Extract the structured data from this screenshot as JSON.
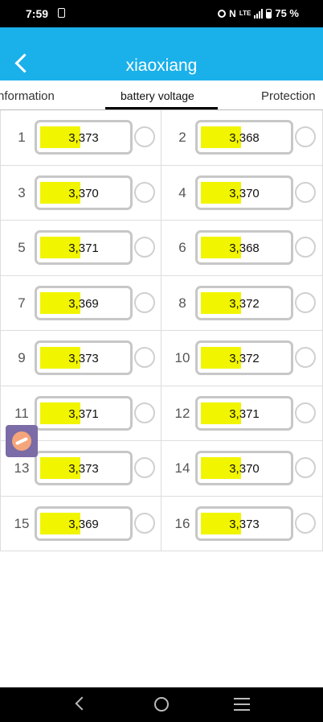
{
  "status_bar": {
    "time": "7:59",
    "battery_percent": "75 %",
    "network_label": "LTE"
  },
  "app_bar": {
    "title": "xiaoxiang"
  },
  "tabs": [
    {
      "label": "nformation"
    },
    {
      "label": "battery voltage",
      "selected": true
    },
    {
      "label": "Protection"
    }
  ],
  "cells": [
    {
      "index": "1",
      "value": "3,373"
    },
    {
      "index": "2",
      "value": "3,368"
    },
    {
      "index": "3",
      "value": "3,370"
    },
    {
      "index": "4",
      "value": "3,370"
    },
    {
      "index": "5",
      "value": "3,371"
    },
    {
      "index": "6",
      "value": "3,368"
    },
    {
      "index": "7",
      "value": "3,369"
    },
    {
      "index": "8",
      "value": "3,372"
    },
    {
      "index": "9",
      "value": "3,373"
    },
    {
      "index": "10",
      "value": "3,372"
    },
    {
      "index": "11",
      "value": "3,371"
    },
    {
      "index": "12",
      "value": "3,371"
    },
    {
      "index": "13",
      "value": "3,373"
    },
    {
      "index": "14",
      "value": "3,370"
    },
    {
      "index": "15",
      "value": "3,369"
    },
    {
      "index": "16",
      "value": "3,373"
    }
  ],
  "colors": {
    "app_bar": "#1ab0ea",
    "voltage_fill": "#f2f500"
  }
}
